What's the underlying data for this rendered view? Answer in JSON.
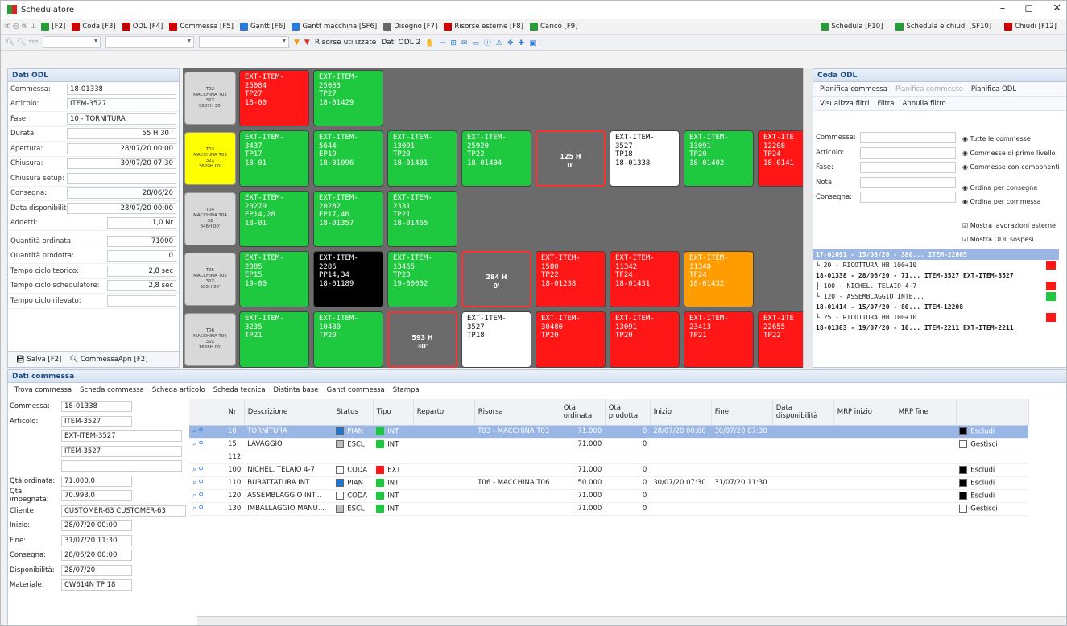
{
  "window": {
    "title": "Schedulatore",
    "minimize": "–",
    "maximize": "◻",
    "close": "✕"
  },
  "menu": {
    "items": [
      {
        "label": "[F2]",
        "color": "#2a9a3a"
      },
      {
        "label": "Coda [F3]",
        "color": "#d00000"
      },
      {
        "label": "ODL [F4]",
        "color": "#c00000"
      },
      {
        "label": "Commessa [F5]",
        "color": "#d00000"
      },
      {
        "label": "Gantt [F6]",
        "color": "#2a7ad6"
      },
      {
        "label": "Gantt macchina [SF6]",
        "color": "#2a7ad6"
      },
      {
        "label": "Disegno [F7]",
        "color": "#666666"
      },
      {
        "label": "Risorse esterne [F8]",
        "color": "#d00000"
      },
      {
        "label": "Carico [F9]",
        "color": "#2a9a3a"
      }
    ],
    "right": [
      "Schedula [F10]",
      "Schedula e chiudi [SF10]",
      "Chiudi [F12]"
    ]
  },
  "toolbar": {
    "filter_label": "Risorse utilizzate",
    "odl_label": "Dati ODL 2"
  },
  "odl": {
    "header": "Dati ODL",
    "fields": [
      {
        "label": "Commessa:",
        "value": "18-01338"
      },
      {
        "label": "Articolo:",
        "value": "ITEM-3527"
      },
      {
        "label": "Fase:",
        "value": "10 - TORNITURA"
      },
      {
        "label": "Durata:",
        "value": "55 H   30 '"
      },
      {
        "label": "Apertura:",
        "value": "28/07/20 00:00"
      },
      {
        "label": "Chiusura:",
        "value": "30/07/20 07:30"
      },
      {
        "label": "Chiusura setup:",
        "value": ""
      },
      {
        "label": "Consegna:",
        "value": "28/06/20"
      },
      {
        "label": "Data disponibilità:",
        "value": "28/07/20 00:00"
      },
      {
        "label": "Addetti:",
        "value": "1,0 Nr"
      },
      {
        "label": "Quantità ordinata:",
        "value": "71000"
      },
      {
        "label": "Quantità prodotta:",
        "value": "0"
      },
      {
        "label": "Tempo ciclo teorico:",
        "value": "2,8 sec"
      },
      {
        "label": "Tempo ciclo schedulatore:",
        "value": "2,8 sec"
      },
      {
        "label": "Tempo ciclo rilevato:",
        "value": ""
      }
    ],
    "save": "Salva [F2]",
    "open": "CommessaApri [F2]"
  },
  "machines": [
    {
      "code": "T02",
      "name": "MACCHINA T02",
      "sub": "32X",
      "hours": "3687H 30'",
      "hl": false
    },
    {
      "code": "T03",
      "name": "MACCHINA T03",
      "sub": "32X",
      "hours": "3629H 00'",
      "hl": true
    },
    {
      "code": "T04",
      "name": "MACCHINA T04",
      "sub": "32",
      "hours": "846H 00'",
      "hl": false
    },
    {
      "code": "T05",
      "name": "MACCHINA T05",
      "sub": "32X",
      "hours": "585H 30'",
      "hl": false
    },
    {
      "code": "T06",
      "name": "MACCHINA T06",
      "sub": "30X",
      "hours": "1668H 00'",
      "hl": false
    }
  ],
  "cards": [
    [
      {
        "c": "r",
        "l": [
          "EXT-ITEM-",
          "25084",
          "TP27",
          "18-00"
        ]
      },
      {
        "c": "g",
        "l": [
          "EXT-ITEM-",
          "25083",
          "TP27",
          "18-01429"
        ]
      }
    ],
    [
      {
        "c": "g",
        "l": [
          "EXT-ITEM-",
          "3437",
          "TP17",
          "18-01"
        ]
      },
      {
        "c": "g",
        "l": [
          "EXT-ITEM-",
          "5644",
          "EP19",
          "18-01096"
        ]
      },
      {
        "c": "g",
        "l": [
          "EXT-ITEM-",
          "13091",
          "TP20",
          "18-01401"
        ]
      },
      {
        "c": "g",
        "l": [
          "EXT-ITEM-",
          "25920",
          "TP22",
          "18-01404"
        ]
      },
      {
        "c": "gap",
        "l": [
          "125 H",
          "0'"
        ]
      },
      {
        "c": "w",
        "l": [
          "EXT-ITEM-",
          "3527",
          "TP18",
          "18-01338"
        ]
      },
      {
        "c": "g",
        "l": [
          "EXT-ITEM-",
          "13091",
          "TP20",
          "18-01402"
        ]
      },
      {
        "c": "r",
        "l": [
          "EXT-ITE",
          "12208",
          "TP24",
          "18-0141"
        ]
      }
    ],
    [
      {
        "c": "g",
        "l": [
          "EXT-ITEM-",
          "20279",
          "EP14,28",
          "18-01"
        ]
      },
      {
        "c": "g",
        "l": [
          "EXT-ITEM-",
          "20282",
          "EP17,46",
          "18-01357"
        ]
      },
      {
        "c": "g",
        "l": [
          "EXT-ITEM-",
          "2331",
          "TP21",
          "18-01465"
        ]
      }
    ],
    [
      {
        "c": "g",
        "l": [
          "EXT-ITEM-",
          "2085",
          "EP15",
          "19-00"
        ]
      },
      {
        "c": "k",
        "l": [
          "EXT-ITEM-",
          "2286",
          "PP14,34",
          "18-01189"
        ]
      },
      {
        "c": "g",
        "l": [
          "EXT-ITEM-",
          "13465",
          "TP23",
          "19-00002"
        ]
      },
      {
        "c": "gap",
        "l": [
          "284 H",
          "0'"
        ]
      },
      {
        "c": "r",
        "l": [
          "EXT-ITEM-",
          "1580",
          "TP22",
          "18-01238"
        ]
      },
      {
        "c": "r",
        "l": [
          "EXT-ITEM-",
          "11342",
          "TF24",
          "18-01431"
        ]
      },
      {
        "c": "o",
        "l": [
          "EXT-ITEM-",
          "11340",
          "TF24",
          "18-01432"
        ]
      }
    ],
    [
      {
        "c": "g",
        "l": [
          "EXT-ITEM-",
          "3235",
          "TP21"
        ]
      },
      {
        "c": "g",
        "l": [
          "EXT-ITEM-",
          "10480",
          "TP20"
        ]
      },
      {
        "c": "gap",
        "l": [
          "593 H",
          "30'"
        ]
      },
      {
        "c": "w",
        "l": [
          "EXT-ITEM-",
          "3527",
          "TP18"
        ]
      },
      {
        "c": "r",
        "l": [
          "EXT-ITEM-",
          "30480",
          "TP20"
        ]
      },
      {
        "c": "r",
        "l": [
          "EXT-ITEM-",
          "13091",
          "TP20"
        ]
      },
      {
        "c": "r",
        "l": [
          "EXT-ITEM-",
          "23413",
          "TP21"
        ]
      },
      {
        "c": "r",
        "l": [
          "EXT-ITE",
          "22655",
          "TP22"
        ]
      }
    ]
  ],
  "coda": {
    "header": "Coda ODL",
    "plan_commessa": "Pianifica commessa",
    "plan_commesse": "Pianifica commesse",
    "plan_odl": "Pianifica ODL",
    "show_filters": "Visualizza filtri",
    "filter": "Filtra",
    "cancel_filter": "Annulla filtro",
    "f_labels": [
      "Commessa:",
      "Articolo:",
      "Fase:",
      "Nota:",
      "Consegna:"
    ],
    "radios": [
      "Tutte le commesse",
      "Commesse di primo livello",
      "Commesse con componenti",
      "Ordina per consegna",
      "Ordina per commessa"
    ],
    "checks": [
      "Mostra lavorazioni esterne",
      "Mostra ODL sospesi"
    ],
    "queue": [
      {
        "t": "17-01691 - 15/03/20 - 380... ITEM-22665",
        "b": true,
        "tag": ""
      },
      {
        "t": "  └ 20 - RICOTTURA HB 100+10",
        "b": false,
        "tag": "#ff1616"
      },
      {
        "t": "18-01338 - 28/06/20 - 71...  ITEM-3527 EXT-ITEM-3527",
        "b": true,
        "tag": ""
      },
      {
        "t": "  ├ 100 - NICHEL. TELAIO 4-7",
        "b": false,
        "tag": "#ff1616"
      },
      {
        "t": "  └ 120 - ASSEMBLAGGIO INTE...",
        "b": false,
        "tag": "#1fc93f"
      },
      {
        "t": "18-01414 - 15/07/20 - 80...  ITEM-12208",
        "b": true,
        "tag": ""
      },
      {
        "t": "  └ 25 - RICOTTURA HB 100+10",
        "b": false,
        "tag": "#ff1616"
      },
      {
        "t": "18-01383 - 19/07/20 - 10...  ITEM-2211 EXT-ITEM-2211",
        "b": true,
        "tag": ""
      }
    ]
  },
  "commessa": {
    "header": "Dati commessa",
    "toolbar": [
      "Trova commessa",
      "Scheda commessa",
      "Scheda articolo",
      "Scheda tecnica",
      "Distinta base",
      "Gantt commessa",
      "Stampa"
    ],
    "fields": [
      {
        "label": "Commessa:",
        "value": "18-01338"
      },
      {
        "label": "Articolo:",
        "value": "ITEM-3527"
      },
      {
        "label": "",
        "value": "EXT-ITEM-3527"
      },
      {
        "label": "",
        "value": "ITEM-3527"
      },
      {
        "label": "",
        "value": ""
      },
      {
        "label": "Qtà ordinata:",
        "value": "71.000,0"
      },
      {
        "label": "Qtà impegnata:",
        "value": "70.993,0"
      },
      {
        "label": "Cliente:",
        "value": "CUSTOMER-63 CUSTOMER-63"
      },
      {
        "label": "Inizio:",
        "value": "28/07/20 00:00"
      },
      {
        "label": "Fine:",
        "value": "31/07/20 11:30"
      },
      {
        "label": "Consegna:",
        "value": "28/06/20 00:00"
      },
      {
        "label": "Disponibilità:",
        "value": "28/07/20"
      },
      {
        "label": "Materiale:",
        "value": "CW614N TP 18"
      }
    ],
    "columns": [
      "Nr",
      "Descrizione",
      "Status",
      "Tipo",
      "Reparto",
      "Risorsa",
      "Qtà ordinata",
      "Qtà prodotta",
      "Inizio",
      "Fine",
      "Data disponibilità",
      "MRP inizio",
      "MRP fine"
    ],
    "rows": [
      {
        "nr": "10",
        "desc": "TORNITURA",
        "status": "PIAN",
        "sc": "#1f77d4",
        "tipo": "INT",
        "tc": "#1fc93f",
        "reparto": "",
        "risorsa": "T03 - MACCHINA T03",
        "qo": "71.000",
        "qp": "0",
        "inizio": "28/07/20 00:00",
        "fine": "30/07/20 07:30",
        "act": "Escludi",
        "sel": true
      },
      {
        "nr": "15",
        "desc": "LAVAGGIO",
        "status": "ESCL",
        "sc": "#bdbdbd",
        "tipo": "INT",
        "tc": "#1fc93f",
        "reparto": "",
        "risorsa": "",
        "qo": "71.000",
        "qp": "0",
        "inizio": "",
        "fine": "",
        "act": "Gestisci",
        "sel": false
      },
      {
        "nr": "112",
        "desc": "",
        "status": "",
        "sc": "",
        "tipo": "",
        "tc": "",
        "reparto": "",
        "risorsa": "",
        "qo": "",
        "qp": "",
        "inizio": "",
        "fine": "",
        "act": "",
        "sel": false
      },
      {
        "nr": "100",
        "desc": "NICHEL. TELAIO 4-7",
        "status": "CODA",
        "sc": "#ffffff",
        "tipo": "EXT",
        "tc": "#ff1616",
        "reparto": "",
        "risorsa": "",
        "qo": "71.000",
        "qp": "0",
        "inizio": "",
        "fine": "",
        "act": "Escludi",
        "sel": false
      },
      {
        "nr": "110",
        "desc": "BURATTATURA INT",
        "status": "PIAN",
        "sc": "#1f77d4",
        "tipo": "INT",
        "tc": "#1fc93f",
        "reparto": "",
        "risorsa": "T06 - MACCHINA T06",
        "qo": "50.000",
        "qp": "0",
        "inizio": "30/07/20 07:30",
        "fine": "31/07/20 11:30",
        "act": "Escludi",
        "sel": false
      },
      {
        "nr": "120",
        "desc": "ASSEMBLAGGIO INT...",
        "status": "CODA",
        "sc": "#ffffff",
        "tipo": "INT",
        "tc": "#1fc93f",
        "reparto": "",
        "risorsa": "",
        "qo": "71.000",
        "qp": "0",
        "inizio": "",
        "fine": "",
        "act": "Escludi",
        "sel": false
      },
      {
        "nr": "130",
        "desc": "IMBALLAGGIO MANU...",
        "status": "ESCL",
        "sc": "#bdbdbd",
        "tipo": "INT",
        "tc": "#1fc93f",
        "reparto": "",
        "risorsa": "",
        "qo": "71.000",
        "qp": "0",
        "inizio": "",
        "fine": "",
        "act": "Gestisci",
        "sel": false
      }
    ]
  }
}
